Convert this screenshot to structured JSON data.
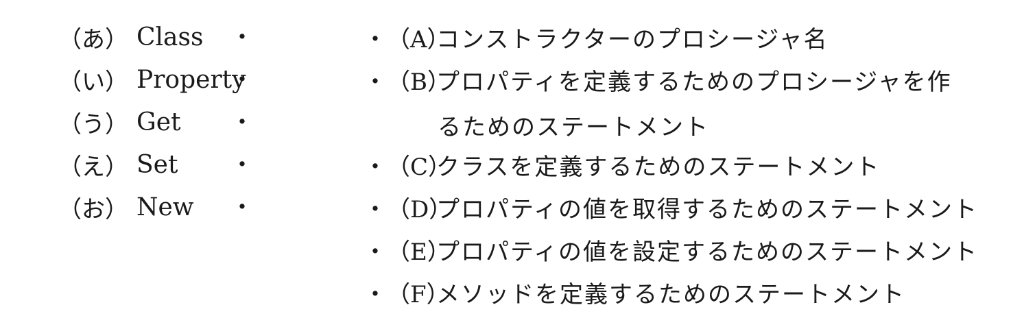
{
  "left_items": [
    {
      "label": "（あ）",
      "keyword": "Class"
    },
    {
      "label": "（い）",
      "keyword": "Property"
    },
    {
      "label": "（う）",
      "keyword": "Get"
    },
    {
      "label": "（え）",
      "keyword": "Set"
    },
    {
      "label": "（お）",
      "keyword": "New"
    }
  ],
  "connector_dot": "・",
  "right_items": [
    {
      "label": "（A）",
      "text": "コンストラクターのプロシージャ名",
      "continuation": ""
    },
    {
      "label": "（B）",
      "text": "プロパティを定義するためのプロシージャを作",
      "continuation": "るためのステートメント"
    },
    {
      "label": "（C）",
      "text": "クラスを定義するためのステートメント",
      "continuation": ""
    },
    {
      "label": "（D）",
      "text": "プロパティの値を取得するためのステートメント",
      "continuation": ""
    },
    {
      "label": "（E）",
      "text": "プロパティの値を設定するためのステートメント",
      "continuation": ""
    },
    {
      "label": "（F）",
      "text": "メソッドを定義するためのステートメント",
      "continuation": ""
    }
  ]
}
